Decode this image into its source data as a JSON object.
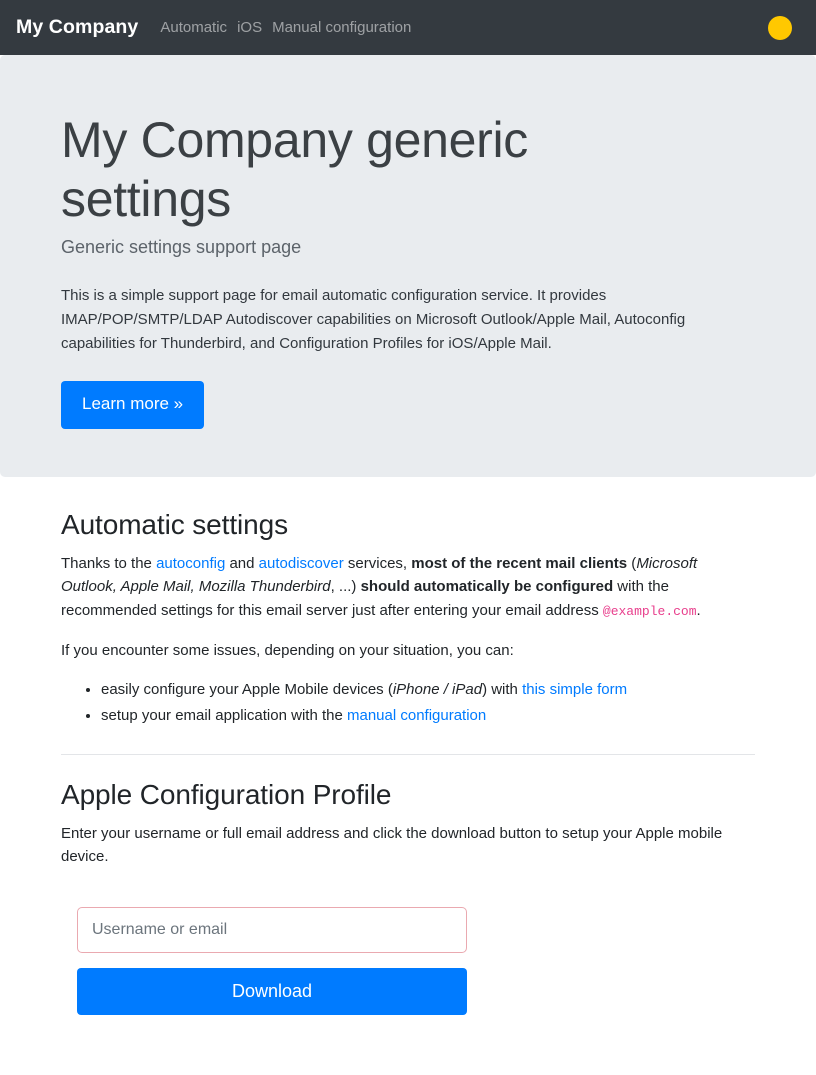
{
  "navbar": {
    "brand": "My Company",
    "links": [
      {
        "label": "Automatic",
        "name": "nav-link-automatic"
      },
      {
        "label": "iOS",
        "name": "nav-link-ios"
      },
      {
        "label": "Manual configuration",
        "name": "nav-link-manual-configuration"
      }
    ],
    "status_dot_color": "#ffc800"
  },
  "jumbotron": {
    "title": "My Company generic settings",
    "subtitle": "Generic settings support page",
    "lead": "This is a simple support page for email automatic configuration service. It provides IMAP/POP/SMTP/LDAP Autodiscover capabilities on Microsoft Outlook/Apple Mail, Autoconfig capabilities for Thunderbird, and Configuration Profiles for iOS/Apple Mail.",
    "cta_label": "Learn more »",
    "background_color": "#e9ecef"
  },
  "automatic_section": {
    "title": "Automatic settings",
    "para1": {
      "t1": "Thanks to the ",
      "link_autoconfig": "autoconfig",
      "t2": " and ",
      "link_autodiscover": "autodiscover",
      "t3": " services, ",
      "bold1": "most of the recent mail clients",
      "t4": " (",
      "italic1": "Microsoft Outlook, Apple Mail, Mozilla Thunderbird",
      "t5": ", ...) ",
      "bold2": "should automatically be configured",
      "t6": " with the recommended settings for this email server just after entering your email address ",
      "code": "@example.com",
      "t7": "."
    },
    "para2": "If you encounter some issues, depending on your situation, you can:",
    "bullets": [
      {
        "t1": "easily configure your Apple Mobile devices (",
        "italic1": "iPhone / iPad",
        "t2": ") with ",
        "link": "this simple form"
      },
      {
        "t1": "setup your email application with the ",
        "link": "manual configuration"
      }
    ]
  },
  "apple_section": {
    "title": "Apple Configuration Profile",
    "description": "Enter your username or full email address and click the download button to setup your Apple mobile device.",
    "input_placeholder": "Username or email",
    "input_value": "",
    "download_label": "Download"
  },
  "colors": {
    "accent_blue": "#007bff",
    "navbar_dark": "#343a40",
    "code_pink": "#e83e8c",
    "input_border_invalid": "#eaa9b0"
  }
}
